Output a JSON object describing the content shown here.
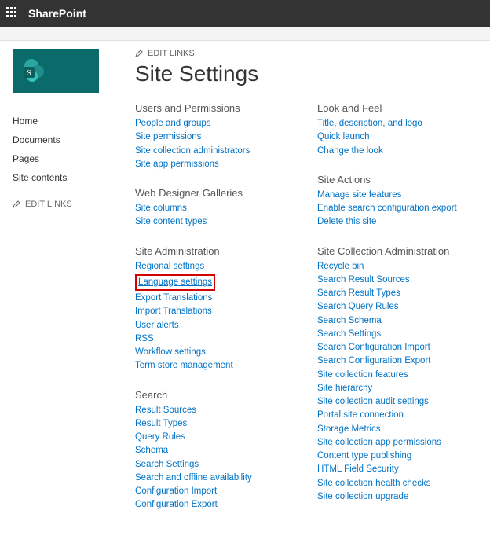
{
  "topbar": {
    "brand": "SharePoint"
  },
  "editLinksLabel": "EDIT LINKS",
  "pageTitle": "Site Settings",
  "nav": {
    "items": [
      {
        "label": "Home"
      },
      {
        "label": "Documents"
      },
      {
        "label": "Pages"
      },
      {
        "label": "Site contents"
      }
    ]
  },
  "leftColumn": [
    {
      "title": "Users and Permissions",
      "links": [
        "People and groups",
        "Site permissions",
        "Site collection administrators",
        "Site app permissions"
      ]
    },
    {
      "title": "Web Designer Galleries",
      "links": [
        "Site columns",
        "Site content types"
      ]
    },
    {
      "title": "Site Administration",
      "links": [
        "Regional settings",
        "Language settings",
        "Export Translations",
        "Import Translations",
        "User alerts",
        "RSS",
        "Workflow settings",
        "Term store management"
      ],
      "highlightIndex": 1
    },
    {
      "title": "Search",
      "links": [
        "Result Sources",
        "Result Types",
        "Query Rules",
        "Schema",
        "Search Settings",
        "Search and offline availability",
        "Configuration Import",
        "Configuration Export"
      ]
    }
  ],
  "rightColumn": [
    {
      "title": "Look and Feel",
      "links": [
        "Title, description, and logo",
        "Quick launch",
        "Change the look"
      ]
    },
    {
      "title": "Site Actions",
      "links": [
        "Manage site features",
        "Enable search configuration export",
        "Delete this site"
      ]
    },
    {
      "title": "Site Collection Administration",
      "links": [
        "Recycle bin",
        "Search Result Sources",
        "Search Result Types",
        "Search Query Rules",
        "Search Schema",
        "Search Settings",
        "Search Configuration Import",
        "Search Configuration Export",
        "Site collection features",
        "Site hierarchy",
        "Site collection audit settings",
        "Portal site connection",
        "Storage Metrics",
        "Site collection app permissions",
        "Content type publishing",
        "HTML Field Security",
        "Site collection health checks",
        "Site collection upgrade"
      ]
    }
  ]
}
